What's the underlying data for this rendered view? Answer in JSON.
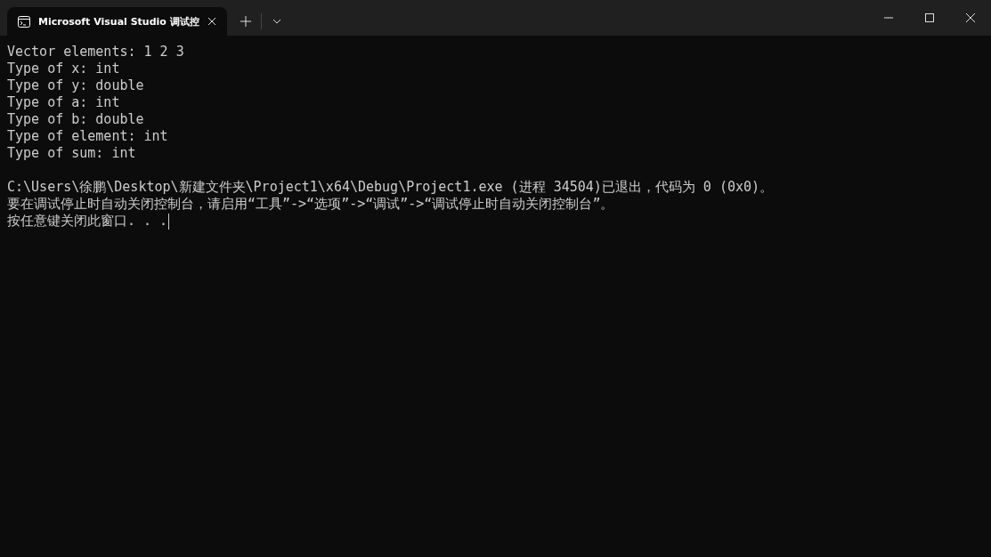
{
  "tab": {
    "title": "Microsoft Visual Studio 调试控",
    "selected": true
  },
  "console": {
    "blocks": [
      [
        "Vector elements: 1 2 3",
        "Type of x: int",
        "Type of y: double",
        "Type of a: int",
        "Type of b: double",
        "Type of element: int",
        "Type of sum: int"
      ],
      [
        "C:\\Users\\徐鹏\\Desktop\\新建文件夹\\Project1\\x64\\Debug\\Project1.exe (进程 34504)已退出，代码为 0 (0x0)。",
        "要在调试停止时自动关闭控制台，请启用“工具”->“选项”->“调试”->“调试停止时自动关闭控制台”。",
        "按任意键关闭此窗口. . ."
      ]
    ]
  }
}
